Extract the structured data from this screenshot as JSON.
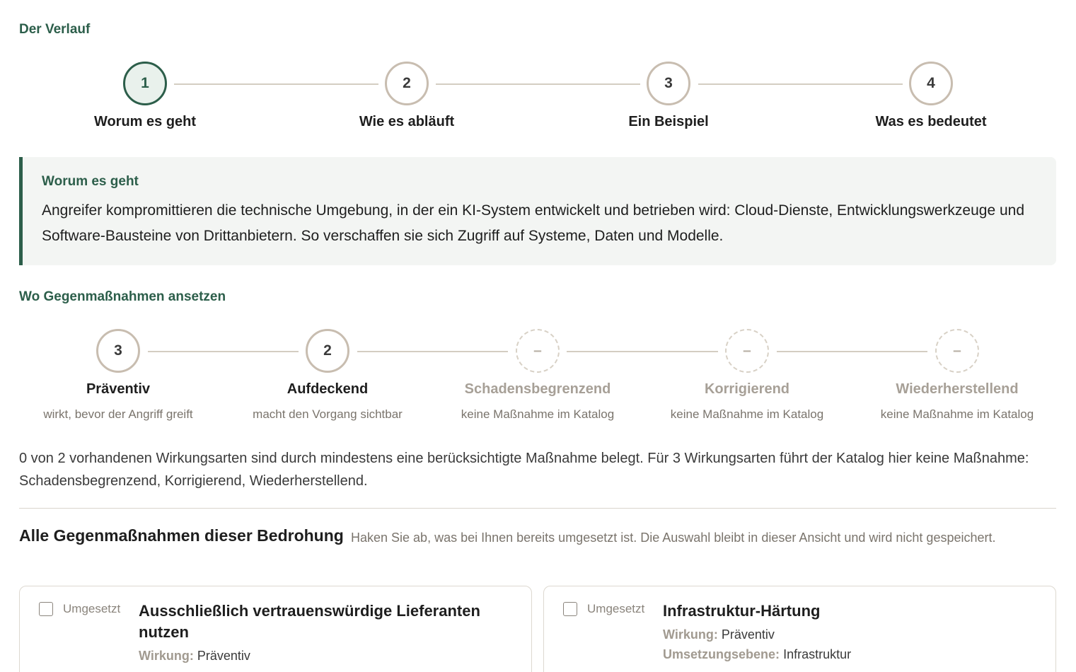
{
  "verlauf": {
    "label": "Der Verlauf",
    "steps": [
      {
        "number": "1",
        "title": "Worum es geht"
      },
      {
        "number": "2",
        "title": "Wie es abläuft"
      },
      {
        "number": "3",
        "title": "Ein Beispiel"
      },
      {
        "number": "4",
        "title": "Was es bedeutet"
      }
    ],
    "active_step": 1
  },
  "info": {
    "title": "Worum es geht",
    "text": "Angreifer kompromittieren die technische Umgebung, in der ein KI-System entwickelt und betrieben wird: Cloud-Dienste, Entwicklungswerkzeuge und Software-Bausteine von Drittanbietern. So verschaffen sie sich Zugriff auf Systeme, Daten und Modelle."
  },
  "gegenmassnahmen": {
    "label": "Wo Gegenmaßnahmen ansetzen",
    "types": [
      {
        "count": "3",
        "title": "Präventiv",
        "subtitle": "wirkt, bevor der Angriff greift",
        "empty": false
      },
      {
        "count": "2",
        "title": "Aufdeckend",
        "subtitle": "macht den Vorgang sichtbar",
        "empty": false
      },
      {
        "count": "–",
        "title": "Schadensbegrenzend",
        "subtitle": "keine Maßnahme im Katalog",
        "empty": true
      },
      {
        "count": "–",
        "title": "Korrigierend",
        "subtitle": "keine Maßnahme im Katalog",
        "empty": true
      },
      {
        "count": "–",
        "title": "Wiederherstellend",
        "subtitle": "keine Maßnahme im Katalog",
        "empty": true
      }
    ],
    "summary": "0 von 2 vorhandenen Wirkungsarten sind durch mindestens eine berücksichtigte Maßnahme belegt. Für 3 Wirkungsarten führt der Katalog hier keine Maßnahme: Schadensbegrenzend, Korrigierend, Wiederherstellend."
  },
  "massnahmen": {
    "heading": "Alle Gegenmaßnahmen dieser Bedrohung",
    "hint": "Haken Sie ab, was bei Ihnen bereits umgesetzt ist. Die Auswahl bleibt in dieser Ansicht und wird nicht gespeichert.",
    "checkbox_label": "Umgesetzt",
    "key_wirkung": "Wirkung:",
    "key_ebene": "Umsetzungsebene:",
    "cards": [
      {
        "title": "Ausschließlich vertrauenswürdige Lieferanten nutzen",
        "wirkung": "Präventiv",
        "checked": false
      },
      {
        "title": "Infrastruktur-Härtung",
        "wirkung": "Präventiv",
        "ebene": "Infrastruktur",
        "checked": false
      }
    ]
  }
}
